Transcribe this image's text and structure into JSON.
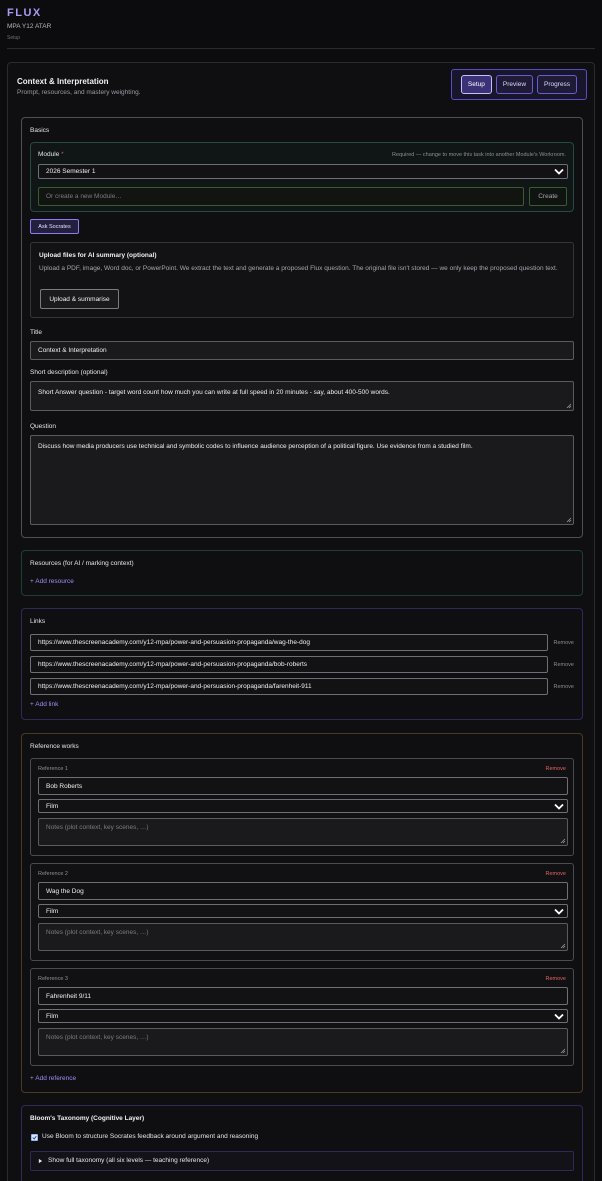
{
  "app": {
    "brand": "FLUX",
    "subtitle": "MPA Y12 ATAR",
    "crumb": "Setup"
  },
  "panel": {
    "title": "Context & Interpretation",
    "subtitle": "Prompt, resources, and mastery weighting.",
    "modes": [
      {
        "label": "Setup",
        "active": true
      },
      {
        "label": "Preview",
        "active": false
      },
      {
        "label": "Progress",
        "active": false
      }
    ]
  },
  "basics": {
    "heading": "Basics",
    "module_label": "Module",
    "module_required_mark": "*",
    "module_hint": "Required — change to move this task into another Module's Workroom.",
    "module_selected": "2026 Semester 1",
    "new_module_placeholder": "Or create a new Module…",
    "create_label": "Create",
    "ask_socrates_label": "Ask Socrates",
    "upload": {
      "title": "Upload files for AI summary (optional)",
      "description": "Upload a PDF, image, Word doc, or PowerPoint. We extract the text and generate a proposed Flux question. The original file isn't stored — we only keep the proposed question text.",
      "button_label": "Upload & summarise"
    },
    "title_label": "Title",
    "title_value": "Context & Interpretation",
    "short_desc_label": "Short description (optional)",
    "short_desc_value": "Short Answer question - target word count how much you can write at full speed in 20 minutes - say, about 400-500 words.",
    "question_label": "Question",
    "question_value": "Discuss how media producers use technical and symbolic codes to influence audience perception of a political figure. Use evidence from a studied film."
  },
  "resources": {
    "heading": "Resources (for AI / marking context)",
    "add_label": "+ Add resource"
  },
  "links": {
    "heading": "Links",
    "items": [
      {
        "url": "https://www.thescreenacademy.com/y12-mpa/power-and-persuasion-propaganda/wag-the-dog",
        "remove": "Remove"
      },
      {
        "url": "https://www.thescreenacademy.com/y12-mpa/power-and-persuasion-propaganda/bob-roberts",
        "remove": "Remove"
      },
      {
        "url": "https://www.thescreenacademy.com/y12-mpa/power-and-persuasion-propaganda/farenheit-911",
        "remove": "Remove"
      }
    ],
    "add_label": "+ Add link"
  },
  "references": {
    "heading": "Reference works",
    "notes_placeholder": "Notes (plot context, key scenes, …)",
    "items": [
      {
        "label": "Reference 1",
        "remove": "Remove",
        "title": "Bob Roberts",
        "type": "Film"
      },
      {
        "label": "Reference 2",
        "remove": "Remove",
        "title": "Wag the Dog",
        "type": "Film"
      },
      {
        "label": "Reference 3",
        "remove": "Remove",
        "title": "Fahrenheit 9/11",
        "type": "Film"
      }
    ],
    "add_label": "+ Add reference"
  },
  "bloom": {
    "heading": "Bloom's Taxonomy (Cognitive Layer)",
    "checkbox_label": "Use Bloom to structure Socrates feedback around argument and reasoning",
    "checked": true,
    "details_label": "Show full taxonomy (all six levels — teaching reference)"
  }
}
